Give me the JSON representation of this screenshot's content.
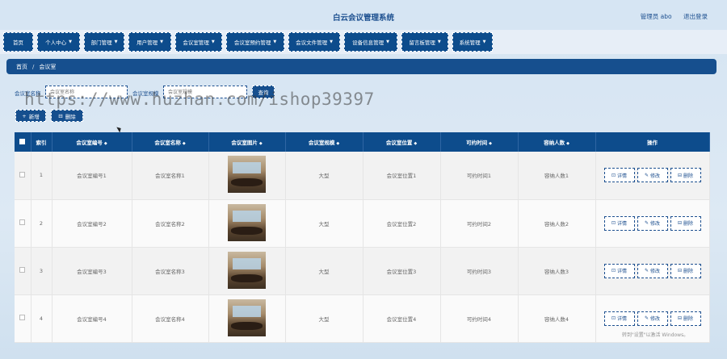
{
  "header": {
    "title": "白云会议管理系统",
    "user_label": "管理员 abo",
    "logout_label": "退出登录"
  },
  "nav": {
    "items": [
      {
        "label": "首页",
        "dropdown": false
      },
      {
        "label": "个人中心",
        "dropdown": true
      },
      {
        "label": "部门管理",
        "dropdown": true
      },
      {
        "label": "用户管理",
        "dropdown": true
      },
      {
        "label": "会议室管理",
        "dropdown": true
      },
      {
        "label": "会议室预约管理",
        "dropdown": true
      },
      {
        "label": "会议文件管理",
        "dropdown": true
      },
      {
        "label": "设备信息管理",
        "dropdown": true
      },
      {
        "label": "留言板管理",
        "dropdown": true
      },
      {
        "label": "系统管理",
        "dropdown": true
      }
    ]
  },
  "breadcrumb": {
    "home": "首页",
    "separator": "/",
    "current": "会议室"
  },
  "search": {
    "name_label": "会议室名称",
    "name_placeholder": "会议室名称",
    "scale_label": "会议室规模",
    "scale_placeholder": "会议室规模",
    "button_label": "查询"
  },
  "actions": {
    "add_label": "新增",
    "delete_label": "删除"
  },
  "watermark_text": "https://www.huzhan.com/ishop39397",
  "table": {
    "columns": [
      "索引",
      "会议室编号",
      "会议室名称",
      "会议室图片",
      "会议室规模",
      "会议室位置",
      "可约时间",
      "容纳人数",
      "操作"
    ],
    "rows": [
      {
        "index": "1",
        "code": "会议室编号1",
        "name": "会议室名称1",
        "scale": "大型",
        "location": "会议室位置1",
        "time": "可约时间1",
        "capacity": "容纳人数1"
      },
      {
        "index": "2",
        "code": "会议室编号2",
        "name": "会议室名称2",
        "scale": "大型",
        "location": "会议室位置2",
        "time": "可约时间2",
        "capacity": "容纳人数2"
      },
      {
        "index": "3",
        "code": "会议室编号3",
        "name": "会议室名称3",
        "scale": "大型",
        "location": "会议室位置3",
        "time": "可约时间3",
        "capacity": "容纳人数3"
      },
      {
        "index": "4",
        "code": "会议室编号4",
        "name": "会议室名称4",
        "scale": "大型",
        "location": "会议室位置4",
        "time": "可约时间4",
        "capacity": "容纳人数4"
      }
    ],
    "row_actions": {
      "detail": "详情",
      "edit": "修改",
      "delete": "删除"
    }
  },
  "os_watermark": "转到\"设置\"以激活 Windows。",
  "colors": {
    "primary": "#0d4c8c",
    "background": "#d6e5f3",
    "accent_text": "#1c4f8f"
  }
}
